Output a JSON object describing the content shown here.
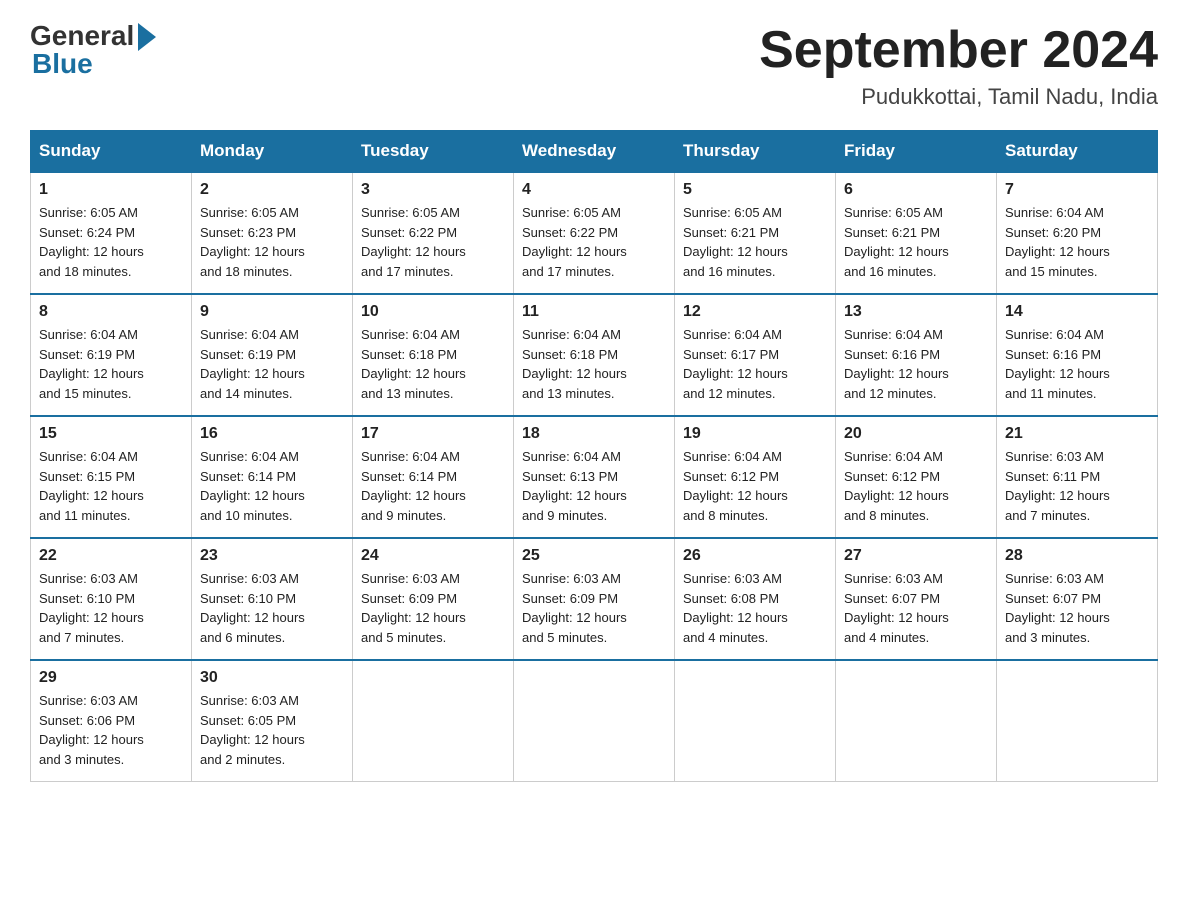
{
  "logo": {
    "general": "General",
    "blue": "Blue"
  },
  "title": "September 2024",
  "subtitle": "Pudukkottai, Tamil Nadu, India",
  "days_of_week": [
    "Sunday",
    "Monday",
    "Tuesday",
    "Wednesday",
    "Thursday",
    "Friday",
    "Saturday"
  ],
  "weeks": [
    [
      {
        "day": "1",
        "sunrise": "6:05 AM",
        "sunset": "6:24 PM",
        "daylight": "12 hours and 18 minutes."
      },
      {
        "day": "2",
        "sunrise": "6:05 AM",
        "sunset": "6:23 PM",
        "daylight": "12 hours and 18 minutes."
      },
      {
        "day": "3",
        "sunrise": "6:05 AM",
        "sunset": "6:22 PM",
        "daylight": "12 hours and 17 minutes."
      },
      {
        "day": "4",
        "sunrise": "6:05 AM",
        "sunset": "6:22 PM",
        "daylight": "12 hours and 17 minutes."
      },
      {
        "day": "5",
        "sunrise": "6:05 AM",
        "sunset": "6:21 PM",
        "daylight": "12 hours and 16 minutes."
      },
      {
        "day": "6",
        "sunrise": "6:05 AM",
        "sunset": "6:21 PM",
        "daylight": "12 hours and 16 minutes."
      },
      {
        "day": "7",
        "sunrise": "6:04 AM",
        "sunset": "6:20 PM",
        "daylight": "12 hours and 15 minutes."
      }
    ],
    [
      {
        "day": "8",
        "sunrise": "6:04 AM",
        "sunset": "6:19 PM",
        "daylight": "12 hours and 15 minutes."
      },
      {
        "day": "9",
        "sunrise": "6:04 AM",
        "sunset": "6:19 PM",
        "daylight": "12 hours and 14 minutes."
      },
      {
        "day": "10",
        "sunrise": "6:04 AM",
        "sunset": "6:18 PM",
        "daylight": "12 hours and 13 minutes."
      },
      {
        "day": "11",
        "sunrise": "6:04 AM",
        "sunset": "6:18 PM",
        "daylight": "12 hours and 13 minutes."
      },
      {
        "day": "12",
        "sunrise": "6:04 AM",
        "sunset": "6:17 PM",
        "daylight": "12 hours and 12 minutes."
      },
      {
        "day": "13",
        "sunrise": "6:04 AM",
        "sunset": "6:16 PM",
        "daylight": "12 hours and 12 minutes."
      },
      {
        "day": "14",
        "sunrise": "6:04 AM",
        "sunset": "6:16 PM",
        "daylight": "12 hours and 11 minutes."
      }
    ],
    [
      {
        "day": "15",
        "sunrise": "6:04 AM",
        "sunset": "6:15 PM",
        "daylight": "12 hours and 11 minutes."
      },
      {
        "day": "16",
        "sunrise": "6:04 AM",
        "sunset": "6:14 PM",
        "daylight": "12 hours and 10 minutes."
      },
      {
        "day": "17",
        "sunrise": "6:04 AM",
        "sunset": "6:14 PM",
        "daylight": "12 hours and 9 minutes."
      },
      {
        "day": "18",
        "sunrise": "6:04 AM",
        "sunset": "6:13 PM",
        "daylight": "12 hours and 9 minutes."
      },
      {
        "day": "19",
        "sunrise": "6:04 AM",
        "sunset": "6:12 PM",
        "daylight": "12 hours and 8 minutes."
      },
      {
        "day": "20",
        "sunrise": "6:04 AM",
        "sunset": "6:12 PM",
        "daylight": "12 hours and 8 minutes."
      },
      {
        "day": "21",
        "sunrise": "6:03 AM",
        "sunset": "6:11 PM",
        "daylight": "12 hours and 7 minutes."
      }
    ],
    [
      {
        "day": "22",
        "sunrise": "6:03 AM",
        "sunset": "6:10 PM",
        "daylight": "12 hours and 7 minutes."
      },
      {
        "day": "23",
        "sunrise": "6:03 AM",
        "sunset": "6:10 PM",
        "daylight": "12 hours and 6 minutes."
      },
      {
        "day": "24",
        "sunrise": "6:03 AM",
        "sunset": "6:09 PM",
        "daylight": "12 hours and 5 minutes."
      },
      {
        "day": "25",
        "sunrise": "6:03 AM",
        "sunset": "6:09 PM",
        "daylight": "12 hours and 5 minutes."
      },
      {
        "day": "26",
        "sunrise": "6:03 AM",
        "sunset": "6:08 PM",
        "daylight": "12 hours and 4 minutes."
      },
      {
        "day": "27",
        "sunrise": "6:03 AM",
        "sunset": "6:07 PM",
        "daylight": "12 hours and 4 minutes."
      },
      {
        "day": "28",
        "sunrise": "6:03 AM",
        "sunset": "6:07 PM",
        "daylight": "12 hours and 3 minutes."
      }
    ],
    [
      {
        "day": "29",
        "sunrise": "6:03 AM",
        "sunset": "6:06 PM",
        "daylight": "12 hours and 3 minutes."
      },
      {
        "day": "30",
        "sunrise": "6:03 AM",
        "sunset": "6:05 PM",
        "daylight": "12 hours and 2 minutes."
      },
      null,
      null,
      null,
      null,
      null
    ]
  ],
  "labels": {
    "sunrise": "Sunrise:",
    "sunset": "Sunset:",
    "daylight": "Daylight:"
  }
}
